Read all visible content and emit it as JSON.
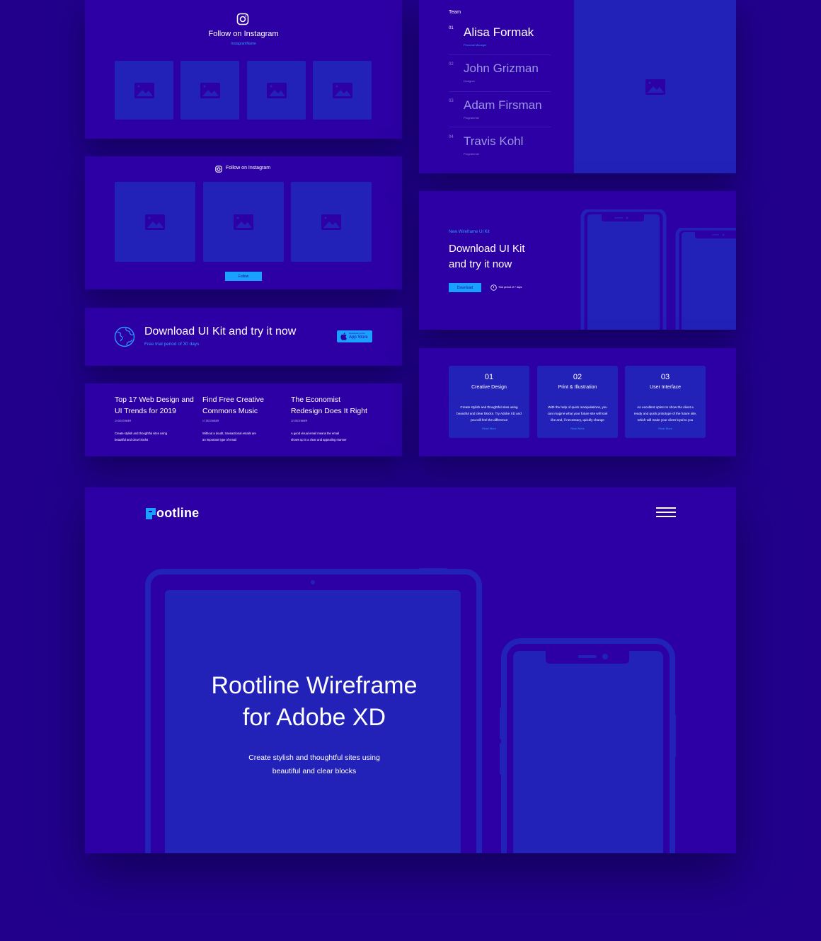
{
  "colors": {
    "background": "#22008c",
    "card": "#2d00a5",
    "placeholder": "#2322b8",
    "accent": "#2f9bff",
    "button": "#1aa0ff"
  },
  "instagram_grid": {
    "icon": "instagram-icon",
    "title": "Follow on Instagram",
    "handle": "InstagramName",
    "images": [
      "image-placeholder",
      "image-placeholder",
      "image-placeholder",
      "image-placeholder"
    ]
  },
  "instagram_follow": {
    "icon": "instagram-icon",
    "title": "Follow on Instagram",
    "images": [
      "image-placeholder",
      "image-placeholder",
      "image-placeholder"
    ],
    "button_label": "Follow"
  },
  "download_banner": {
    "icon": "globe-icon",
    "title": "Download UI Kit and try it now",
    "subtitle": "Free trial period of 30 days",
    "store_small": "Download on the",
    "store_label": "App Store"
  },
  "articles": [
    {
      "title_line1": "Top 17 Web Design and",
      "title_line2": "UI Trends for 2019",
      "date": "24 DECEMBER",
      "desc_line1": "Create stylish and thoughtful sites using",
      "desc_line2": "beautiful and clear blocks"
    },
    {
      "title_line1": "Find Free Creative",
      "title_line2": "Commons Music",
      "date": "17 DECEMBER",
      "desc_line1": "Without a doubt, transactional emails are",
      "desc_line2": "an important type of email"
    },
    {
      "title_line1": "The Economist",
      "title_line2": "Redesign Does It Right",
      "date": "12 DECEMBER",
      "desc_line1": "A good visual email means the email",
      "desc_line2": "shows up in a clear and appealing manner"
    }
  ],
  "team": {
    "heading": "Team",
    "members": [
      {
        "num": "01",
        "name": "Alisa Formak",
        "role": "Personal Manager",
        "active": true
      },
      {
        "num": "02",
        "name": "John Grizman",
        "role": "Designer",
        "active": false
      },
      {
        "num": "03",
        "name": "Adam Firsman",
        "role": "Programmer",
        "active": false
      },
      {
        "num": "04",
        "name": "Travis Kohl",
        "role": "Programmer",
        "active": false
      }
    ]
  },
  "download_kit": {
    "eyebrow": "New Wireframe UI Kit",
    "title_line1": "Download UI Kit",
    "title_line2": "and try it now",
    "button_label": "Download",
    "trial_note": "Trial period of 7 days"
  },
  "services": [
    {
      "num": "01",
      "title": "Creative Design",
      "desc": [
        "Create stylish and thoughtful sites using",
        "beautiful and clear blocks. Try Adobe XD and",
        "you will feel the difference"
      ],
      "link": "Read More"
    },
    {
      "num": "02",
      "title": "Print & Illustration",
      "desc": [
        "With the help of quick manipulations, you",
        "can imagine what your future site will look",
        "like and, if necessary, quickly change"
      ],
      "link": "Read More"
    },
    {
      "num": "03",
      "title": "User Interface",
      "desc": [
        "An excellent option to show the client a",
        "ready and quick prototype of the future site,",
        "which will make your client loyal to you"
      ],
      "link": "Read More"
    }
  ],
  "hero": {
    "logo_text": "ootline",
    "logo_mark": "R",
    "menu_icon": "hamburger-menu-icon",
    "title_line1": "Rootline Wireframe",
    "title_line2": "for Adobe XD",
    "desc_line1": "Create stylish and thoughtful sites using",
    "desc_line2": "beautiful and clear blocks"
  }
}
